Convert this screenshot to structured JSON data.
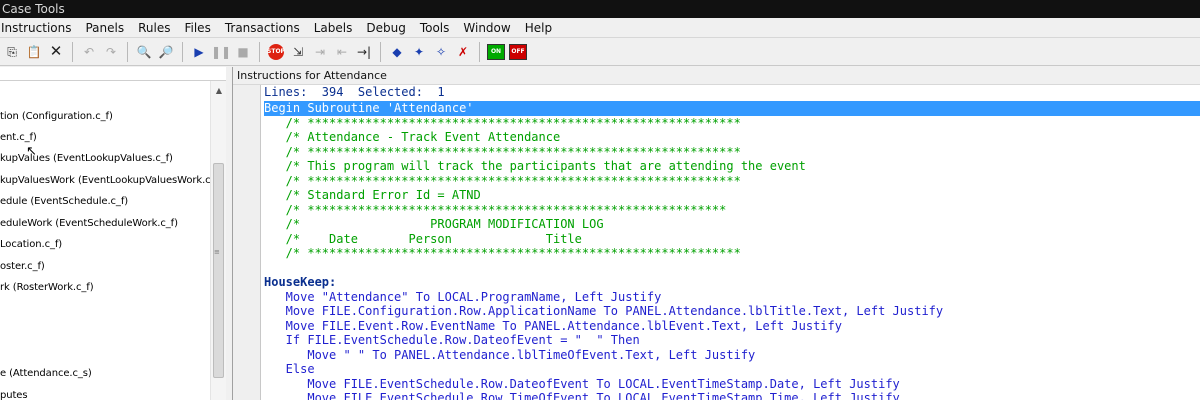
{
  "titlebar": {
    "title": "Case Tools"
  },
  "menu": [
    "Instructions",
    "Panels",
    "Rules",
    "Files",
    "Transactions",
    "Labels",
    "Debug",
    "Tools",
    "Window",
    "Help"
  ],
  "toolbar": {
    "icons": [
      "copy-icon",
      "paste-icon",
      "delete-icon",
      "undo-icon",
      "redo-icon",
      "find-icon",
      "find-next-icon",
      "run-icon",
      "pause-icon",
      "stop-square-icon",
      "stop-icon",
      "step-into-icon",
      "step-over-icon",
      "step-out-icon",
      "run-to-cursor-icon",
      "breakpoint-icon",
      "breakpoint-enable-icon",
      "breakpoint-clear-icon",
      "breakpoint-delete-icon",
      "trace-on-icon",
      "trace-off-icon"
    ],
    "stop_label": "STOP",
    "trace_on_label": "ON",
    "trace_off_label": "OFF"
  },
  "tree": {
    "items": [
      "tion (Configuration.c_f)",
      "ent.c_f)",
      "kupValues (EventLookupValues.c_f)",
      "kupValuesWork (EventLookupValuesWork.c_f)",
      "edule (EventSchedule.c_f)",
      "eduleWork (EventScheduleWork.c_f)",
      "Location.c_f)",
      "oster.c_f)",
      "rk (RosterWork.c_f)",
      "e (Attendance.c_s)",
      "putes"
    ]
  },
  "editor": {
    "title": "Instructions for Attendance",
    "status": "Lines:  394  Selected:  1",
    "lines": [
      {
        "t": "Begin Subroutine 'Attendance'",
        "k": "selected"
      },
      {
        "t": "   /* ************************************************************",
        "k": "comment"
      },
      {
        "t": "   /* Attendance - Track Event Attendance",
        "k": "comment"
      },
      {
        "t": "   /* ************************************************************",
        "k": "comment"
      },
      {
        "t": "   /* This program will track the participants that are attending the event",
        "k": "comment"
      },
      {
        "t": "   /* ************************************************************",
        "k": "comment"
      },
      {
        "t": "   /* Standard Error Id = ATND",
        "k": "comment"
      },
      {
        "t": "   /* **********************************************************",
        "k": "comment"
      },
      {
        "t": "   /*                  PROGRAM MODIFICATION LOG",
        "k": "comment"
      },
      {
        "t": "   /*    Date       Person             Title",
        "k": "comment"
      },
      {
        "t": "   /* ************************************************************",
        "k": "comment"
      },
      {
        "t": "",
        "k": "code"
      },
      {
        "t": "HouseKeep:",
        "k": "label"
      },
      {
        "t": "   Move \"Attendance\" To LOCAL.ProgramName, Left Justify",
        "k": "code"
      },
      {
        "t": "   Move FILE.Configuration.Row.ApplicationName To PANEL.Attendance.lblTitle.Text, Left Justify",
        "k": "code"
      },
      {
        "t": "   Move FILE.Event.Row.EventName To PANEL.Attendance.lblEvent.Text, Left Justify",
        "k": "code"
      },
      {
        "t": "   If FILE.EventSchedule.Row.DateofEvent = \"  \" Then",
        "k": "code"
      },
      {
        "t": "      Move \" \" To PANEL.Attendance.lblTimeOfEvent.Text, Left Justify",
        "k": "code"
      },
      {
        "t": "   Else",
        "k": "code"
      },
      {
        "t": "      Move FILE.EventSchedule.Row.DateofEvent To LOCAL.EventTimeStamp.Date, Left Justify",
        "k": "code"
      },
      {
        "t": "      Move FILE.EventSchedule.Row.TimeOfEvent To LOCAL.EventTimeStamp.Time, Left Justify",
        "k": "code"
      }
    ]
  },
  "colors": {
    "selection": "#3399ff",
    "comment": "#00a000",
    "code": "#1f1fcf",
    "label": "#0a2f8f"
  }
}
